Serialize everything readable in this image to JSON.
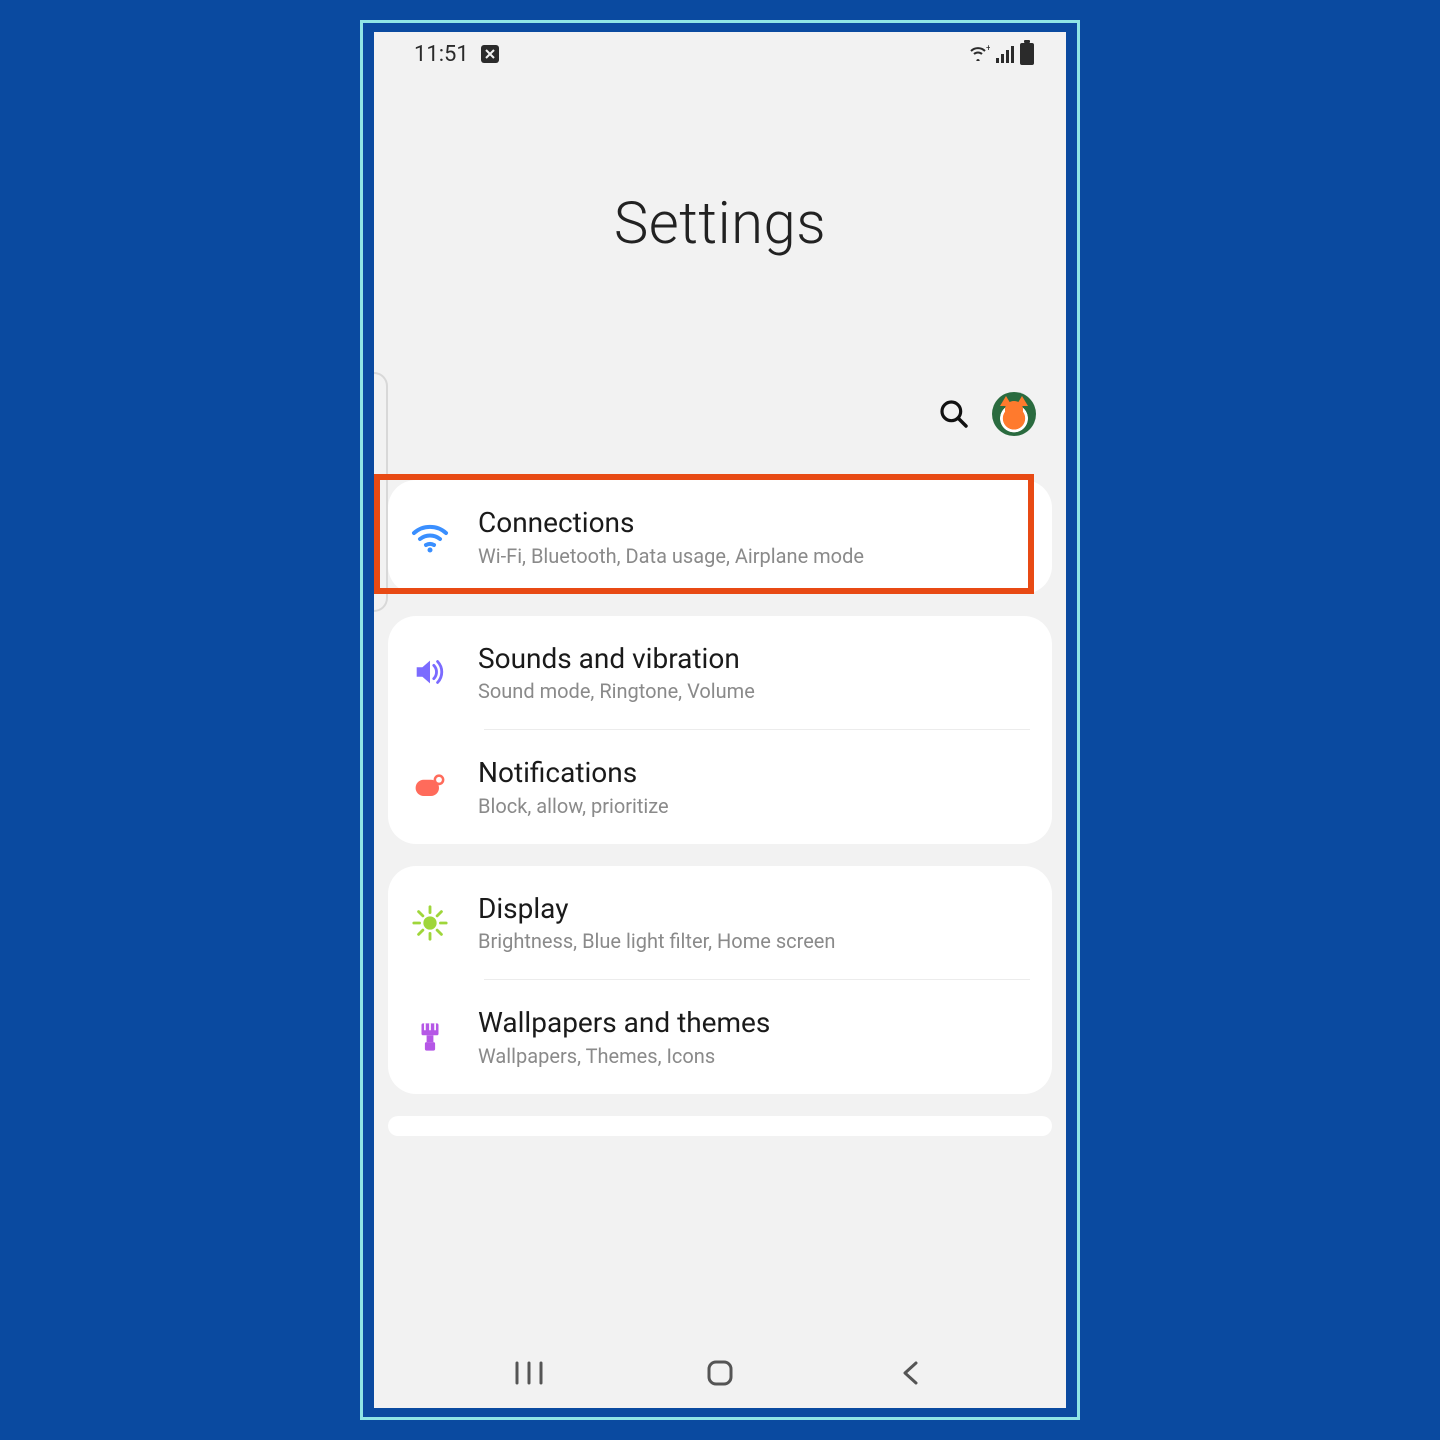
{
  "status": {
    "time": "11:51"
  },
  "header": {
    "title": "Settings"
  },
  "groups": [
    {
      "items": [
        {
          "icon": "wifi",
          "color": "#3a8fff",
          "title": "Connections",
          "subtitle": "Wi-Fi, Bluetooth, Data usage, Airplane mode",
          "highlighted": true
        }
      ]
    },
    {
      "items": [
        {
          "icon": "volume",
          "color": "#7b6bff",
          "title": "Sounds and vibration",
          "subtitle": "Sound mode, Ringtone, Volume"
        },
        {
          "icon": "notif",
          "color": "#ff6b5b",
          "title": "Notifications",
          "subtitle": "Block, allow, prioritize"
        }
      ]
    },
    {
      "items": [
        {
          "icon": "sun",
          "color": "#9fd63a",
          "title": "Display",
          "subtitle": "Brightness, Blue light filter, Home screen"
        },
        {
          "icon": "brush",
          "color": "#b557e6",
          "title": "Wallpapers and themes",
          "subtitle": "Wallpapers, Themes, Icons"
        }
      ]
    }
  ]
}
